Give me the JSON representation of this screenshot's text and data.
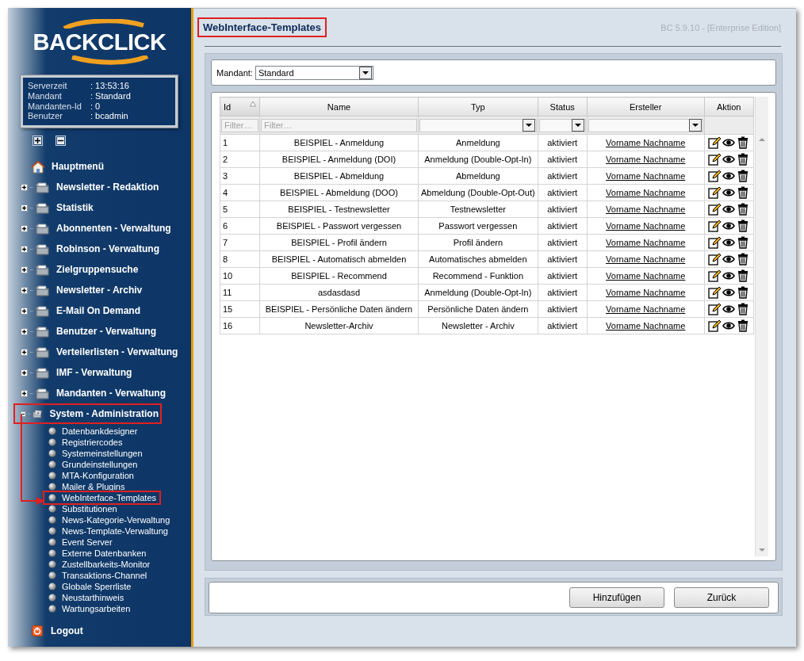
{
  "sidebar": {
    "logo": "BACKCLICK",
    "info": [
      {
        "label": "Serverzeit",
        "value": ": 13:53:16"
      },
      {
        "label": "Mandant",
        "value": ": Standard"
      },
      {
        "label": "Mandanten-Id",
        "value": ": 0"
      },
      {
        "label": "Benutzer",
        "value": ": bcadmin"
      }
    ],
    "nav": [
      {
        "kind": "home",
        "label": "Hauptmenü"
      },
      {
        "kind": "section",
        "label": "Newsletter - Redaktion",
        "expanded": false,
        "annotated": false
      },
      {
        "kind": "section",
        "label": "Statistik",
        "expanded": false,
        "annotated": false
      },
      {
        "kind": "section",
        "label": "Abonnenten - Verwaltung",
        "expanded": false,
        "annotated": false
      },
      {
        "kind": "section",
        "label": "Robinson - Verwaltung",
        "expanded": false,
        "annotated": false
      },
      {
        "kind": "section",
        "label": "Zielgruppensuche",
        "expanded": false,
        "annotated": false
      },
      {
        "kind": "section",
        "label": "Newsletter - Archiv",
        "expanded": false,
        "annotated": false
      },
      {
        "kind": "section",
        "label": "E-Mail On Demand",
        "expanded": false,
        "annotated": false
      },
      {
        "kind": "section",
        "label": "Benutzer - Verwaltung",
        "expanded": false,
        "annotated": false
      },
      {
        "kind": "section",
        "label": "Verteilerlisten - Verwaltung",
        "expanded": false,
        "annotated": false
      },
      {
        "kind": "section",
        "label": "IMF - Verwaltung",
        "expanded": false,
        "annotated": false
      },
      {
        "kind": "section",
        "label": "Mandanten - Verwaltung",
        "expanded": false,
        "annotated": false
      },
      {
        "kind": "section",
        "label": "System - Administration",
        "expanded": true,
        "annotated": true,
        "children": [
          {
            "label": "Datenbankdesigner",
            "annotated": false
          },
          {
            "label": "Registriercodes",
            "annotated": false
          },
          {
            "label": "Systemeinstellungen",
            "annotated": false
          },
          {
            "label": "Grundeinstellungen",
            "annotated": false
          },
          {
            "label": "MTA-Konfiguration",
            "annotated": false
          },
          {
            "label": "Mailer & Plugins",
            "annotated": false
          },
          {
            "label": "WebInterface-Templates",
            "annotated": true
          },
          {
            "label": "Substitutionen",
            "annotated": false
          },
          {
            "label": "News-Kategorie-Verwaltung",
            "annotated": false
          },
          {
            "label": "News-Template-Verwaltung",
            "annotated": false
          },
          {
            "label": "Event Server",
            "annotated": false
          },
          {
            "label": "Externe Datenbanken",
            "annotated": false
          },
          {
            "label": "Zustellbarkeits-Monitor",
            "annotated": false
          },
          {
            "label": "Transaktions-Channel",
            "annotated": false
          },
          {
            "label": "Globale Sperrliste",
            "annotated": false
          },
          {
            "label": "Neustarthinweis",
            "annotated": false
          },
          {
            "label": "Wartungsarbeiten",
            "annotated": false
          }
        ]
      },
      {
        "kind": "logout",
        "label": "Logout"
      }
    ]
  },
  "header": {
    "title": "WebInterface-Templates",
    "annotated": true,
    "version": "BC 5.9.10 - [Enterprise Edition]"
  },
  "mandant": {
    "label": "Mandant:",
    "value": "Standard"
  },
  "table": {
    "columns": [
      {
        "label": "Id",
        "kind": "text",
        "placeholder": "Filter…",
        "sorted": true
      },
      {
        "label": "Name",
        "kind": "text",
        "placeholder": "Filter…",
        "sorted": false
      },
      {
        "label": "Typ",
        "kind": "dropdown",
        "sorted": false
      },
      {
        "label": "Status",
        "kind": "dropdown",
        "sorted": false
      },
      {
        "label": "Ersteller",
        "kind": "dropdown",
        "sorted": false
      },
      {
        "label": "Aktion",
        "kind": "none",
        "sorted": false
      }
    ],
    "rows": [
      {
        "id": "1",
        "name": "BEISPIEL - Anmeldung",
        "typ": "Anmeldung",
        "status": "aktiviert",
        "creator": "Vorname Nachname"
      },
      {
        "id": "2",
        "name": "BEISPIEL - Anmeldung (DOI)",
        "typ": "Anmeldung (Double-Opt-In)",
        "status": "aktiviert",
        "creator": "Vorname Nachname"
      },
      {
        "id": "3",
        "name": "BEISPIEL - Abmeldung",
        "typ": "Abmeldung",
        "status": "aktiviert",
        "creator": "Vorname Nachname"
      },
      {
        "id": "4",
        "name": "BEISPIEL - Abmeldung (DOO)",
        "typ": "Abmeldung (Double-Opt-Out)",
        "status": "aktiviert",
        "creator": "Vorname Nachname"
      },
      {
        "id": "5",
        "name": "BEISPIEL - Testnewsletter",
        "typ": "Testnewsletter",
        "status": "aktiviert",
        "creator": "Vorname Nachname"
      },
      {
        "id": "6",
        "name": "BEISPIEL - Passwort vergessen",
        "typ": "Passwort vergessen",
        "status": "aktiviert",
        "creator": "Vorname Nachname"
      },
      {
        "id": "7",
        "name": "BEISPIEL - Profil ändern",
        "typ": "Profil ändern",
        "status": "aktiviert",
        "creator": "Vorname Nachname"
      },
      {
        "id": "8",
        "name": "BEISPIEL - Automatisch abmelden",
        "typ": "Automatisches abmelden",
        "status": "aktiviert",
        "creator": "Vorname Nachname"
      },
      {
        "id": "10",
        "name": "BEISPIEL - Recommend",
        "typ": "Recommend - Funktion",
        "status": "aktiviert",
        "creator": "Vorname Nachname"
      },
      {
        "id": "11",
        "name": "asdasdasd",
        "typ": "Anmeldung (Double-Opt-In)",
        "status": "aktiviert",
        "creator": "Vorname Nachname"
      },
      {
        "id": "15",
        "name": "BEISPIEL - Persönliche Daten ändern",
        "typ": "Persönliche Daten ändern",
        "status": "aktiviert",
        "creator": "Vorname Nachname"
      },
      {
        "id": "16",
        "name": "Newsletter-Archiv",
        "typ": "Newsletter - Archiv",
        "status": "aktiviert",
        "creator": "Vorname Nachname"
      }
    ]
  },
  "buttons": [
    "Hinzufügen",
    "Zurück"
  ]
}
